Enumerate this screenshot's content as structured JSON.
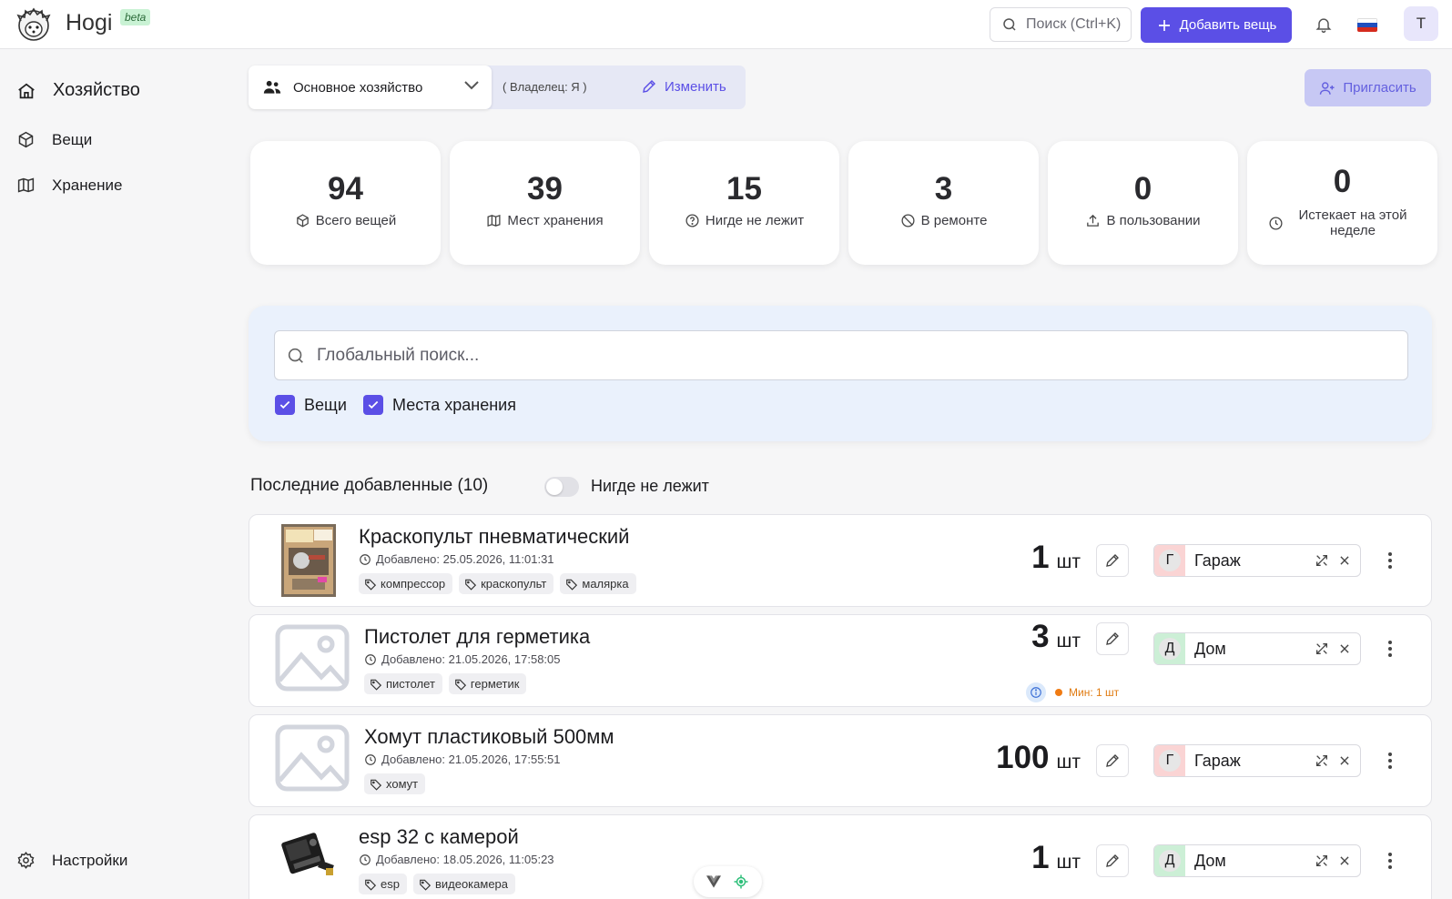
{
  "header": {
    "brand": "Hogi",
    "badge": "beta",
    "search_placeholder": "Поиск (Ctrl+K)",
    "add_label": "Добавить вещь",
    "avatar_initial": "T",
    "accent_color": "#5b4fe6"
  },
  "sidebar": {
    "items": [
      {
        "label": "Хозяйство",
        "icon": "home-icon",
        "active": true
      },
      {
        "label": "Вещи",
        "icon": "box-icon"
      },
      {
        "label": "Хранение",
        "icon": "map-icon"
      }
    ],
    "settings_label": "Настройки"
  },
  "household": {
    "name": "Основное хозяйство",
    "owner": "( Владелец: Я )",
    "edit_label": "Изменить",
    "invite_label": "Пригласить"
  },
  "stats": [
    {
      "value": "94",
      "label": "Всего вещей",
      "icon": "box-icon"
    },
    {
      "value": "39",
      "label": "Мест хранения",
      "icon": "map-icon"
    },
    {
      "value": "15",
      "label": "Нигде не лежит",
      "icon": "question-icon"
    },
    {
      "value": "3",
      "label": "В ремонте",
      "icon": "ban-icon"
    },
    {
      "value": "0",
      "label": "В пользовании",
      "icon": "upload-icon"
    },
    {
      "value": "0",
      "label": "Истекает на этой неделе",
      "icon": "clock-icon"
    }
  ],
  "global_search": {
    "placeholder": "Глобальный поиск...",
    "filters": [
      {
        "label": "Вещи",
        "checked": true
      },
      {
        "label": "Места хранения",
        "checked": true
      }
    ]
  },
  "recent": {
    "title": "Последние добавленные (10)",
    "toggle_label": "Нигде не лежит",
    "toggle_on": false,
    "items": [
      {
        "name": "Краскопульт пневматический",
        "added": "Добавлено: 25.05.2026, 11:01:31",
        "tags": [
          "компрессор",
          "краскопульт",
          "малярка"
        ],
        "qty": "1",
        "unit": "шт",
        "location": "Гараж",
        "location_letter": "Г"
      },
      {
        "name": "Пистолет для герметика",
        "added": "Добавлено: 21.05.2026, 17:58:05",
        "tags": [
          "пистолет",
          "герметик"
        ],
        "qty": "3",
        "unit": "шт",
        "min": "Мин: 1 шт",
        "location": "Дом",
        "location_letter": "Д"
      },
      {
        "name": "Хомут пластиковый 500мм",
        "added": "Добавлено: 21.05.2026, 17:55:51",
        "tags": [
          "хомут"
        ],
        "qty": "100",
        "unit": "шт",
        "location": "Гараж",
        "location_letter": "Г"
      },
      {
        "name": "esp 32 с камерой",
        "added": "Добавлено: 18.05.2026, 11:05:23",
        "tags": [
          "esp",
          "видеокамера"
        ],
        "qty": "1",
        "unit": "шт",
        "location": "Дом",
        "location_letter": "Д"
      }
    ]
  }
}
